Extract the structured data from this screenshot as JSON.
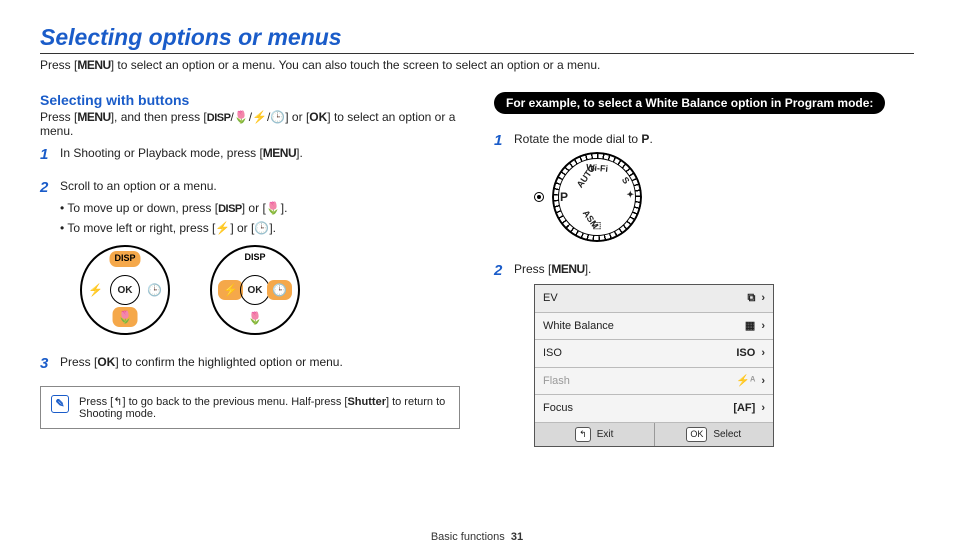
{
  "title": "Selecting options or menus",
  "intro_pre": "Press [",
  "intro_menu": "MENU",
  "intro_post": "] to select an option or a menu. You can also touch the screen to select an option or a menu.",
  "left": {
    "heading": "Selecting with buttons",
    "sub_pre": "Press [",
    "sub_menu": "MENU",
    "sub_mid": "], and then press [",
    "sub_disp": "DISP",
    "sub_icons": "/🌷/⚡/🕒",
    "sub_or": "] or [",
    "sub_ok": "OK",
    "sub_post": "] to select an option or a menu.",
    "step1_pre": "In Shooting or Playback mode, press [",
    "step1_menu": "MENU",
    "step1_post": "].",
    "step2": "Scroll to an option or a menu.",
    "b1_pre": "To move up or down, press [",
    "b1_disp": "DISP",
    "b1_or": "] or [",
    "b1_icon": "🌷",
    "b1_post": "].",
    "b2_pre": "To move left or right, press [",
    "b2_icon1": "⚡",
    "b2_or": "] or [",
    "b2_icon2": "🕒",
    "b2_post": "].",
    "pad_top": "DISP",
    "pad_ok": "OK",
    "pad_left": "⚡",
    "pad_right": "🕒",
    "pad_bot": "🌷",
    "step3_pre": "Press [",
    "step3_ok": "OK",
    "step3_post": "] to confirm the highlighted option or menu.",
    "note_pre": "Press [",
    "note_back": "↰",
    "note_mid": "] to go back to the previous menu. Half-press [",
    "note_shutter": "Shutter",
    "note_post": "] to return to Shooting mode."
  },
  "right": {
    "pill": "For example, to select a White Balance option in Program mode:",
    "r1_pre": "Rotate the mode dial to ",
    "r1_p": "P",
    "r1_post": ".",
    "dial": {
      "p": "P",
      "auto": "AUTO",
      "wifi": "Wi-Fi",
      "scn": "S",
      "asm": "ASM",
      "smart": "⬚",
      "star": "✦"
    },
    "r2_pre": "Press [",
    "r2_menu": "MENU",
    "r2_post": "].",
    "menu": {
      "items": [
        {
          "label": "EV",
          "icon": "⧉",
          "dis": false
        },
        {
          "label": "White Balance",
          "icon": "▦",
          "dis": false
        },
        {
          "label": "ISO",
          "icon": "ISO",
          "dis": false
        },
        {
          "label": "Flash",
          "icon": "⚡ᴬ",
          "dis": true
        },
        {
          "label": "Focus",
          "icon": "[AF]",
          "dis": false
        }
      ],
      "exit_icon": "↰",
      "exit": "Exit",
      "select_icon": "OK",
      "select": "Select"
    }
  },
  "footer_section": "Basic functions",
  "footer_page": "31"
}
